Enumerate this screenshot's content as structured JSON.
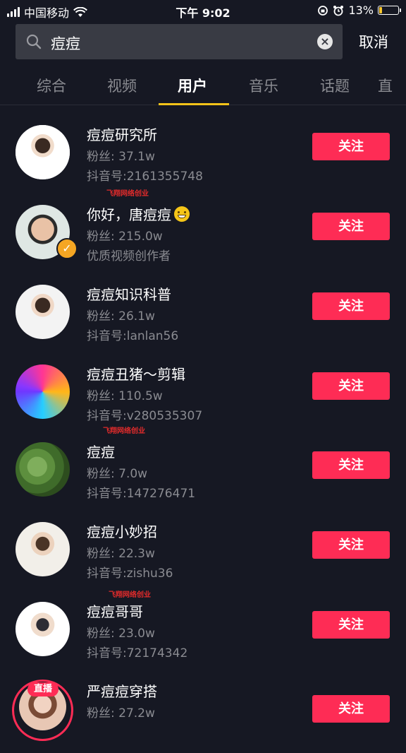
{
  "status_bar": {
    "carrier": "中国移动",
    "time": "下午 9:02",
    "battery": "13%",
    "battery_color": "#f7c52b"
  },
  "search": {
    "query": "痘痘",
    "cancel_label": "取消",
    "icon": "search-icon",
    "clear_icon": "clear-icon"
  },
  "tabs": [
    {
      "label": "综合"
    },
    {
      "label": "视频"
    },
    {
      "label": "用户",
      "active": true
    },
    {
      "label": "音乐"
    },
    {
      "label": "话题"
    },
    {
      "label": "直"
    }
  ],
  "watermark": "飞翔网络创业",
  "users": [
    {
      "name": "痘痘研究所",
      "fans": "粉丝: 37.1w",
      "sub": "抖音号:2161355748",
      "follow": "关注"
    },
    {
      "name": "你好，唐痘痘",
      "fans": "粉丝: 215.0w",
      "sub": "优质视频创作者",
      "follow": "关注",
      "verified": true,
      "emoji": "grinning-face"
    },
    {
      "name": "痘痘知识科普",
      "fans": "粉丝: 26.1w",
      "sub": "抖音号:lanlan56",
      "follow": "关注"
    },
    {
      "name": "痘痘丑猪～剪辑",
      "fans": "粉丝: 110.5w",
      "sub": "抖音号:v280535307",
      "follow": "关注"
    },
    {
      "name": "痘痘",
      "fans": "粉丝: 7.0w",
      "sub": "抖音号:147276471",
      "follow": "关注"
    },
    {
      "name": "痘痘小妙招",
      "fans": "粉丝: 22.3w",
      "sub": "抖音号:zishu36",
      "follow": "关注"
    },
    {
      "name": "痘痘哥哥",
      "fans": "粉丝: 23.0w",
      "sub": "抖音号:72174342",
      "follow": "关注"
    },
    {
      "name": "严痘痘穿搭",
      "fans": "粉丝: 27.2w",
      "sub": "",
      "follow": "关注",
      "live": "直播"
    }
  ],
  "colors": {
    "background": "#161823",
    "accent_follow": "#fe2c55",
    "tab_indicator": "#f4c31a",
    "secondary_text": "#8a8b91"
  }
}
